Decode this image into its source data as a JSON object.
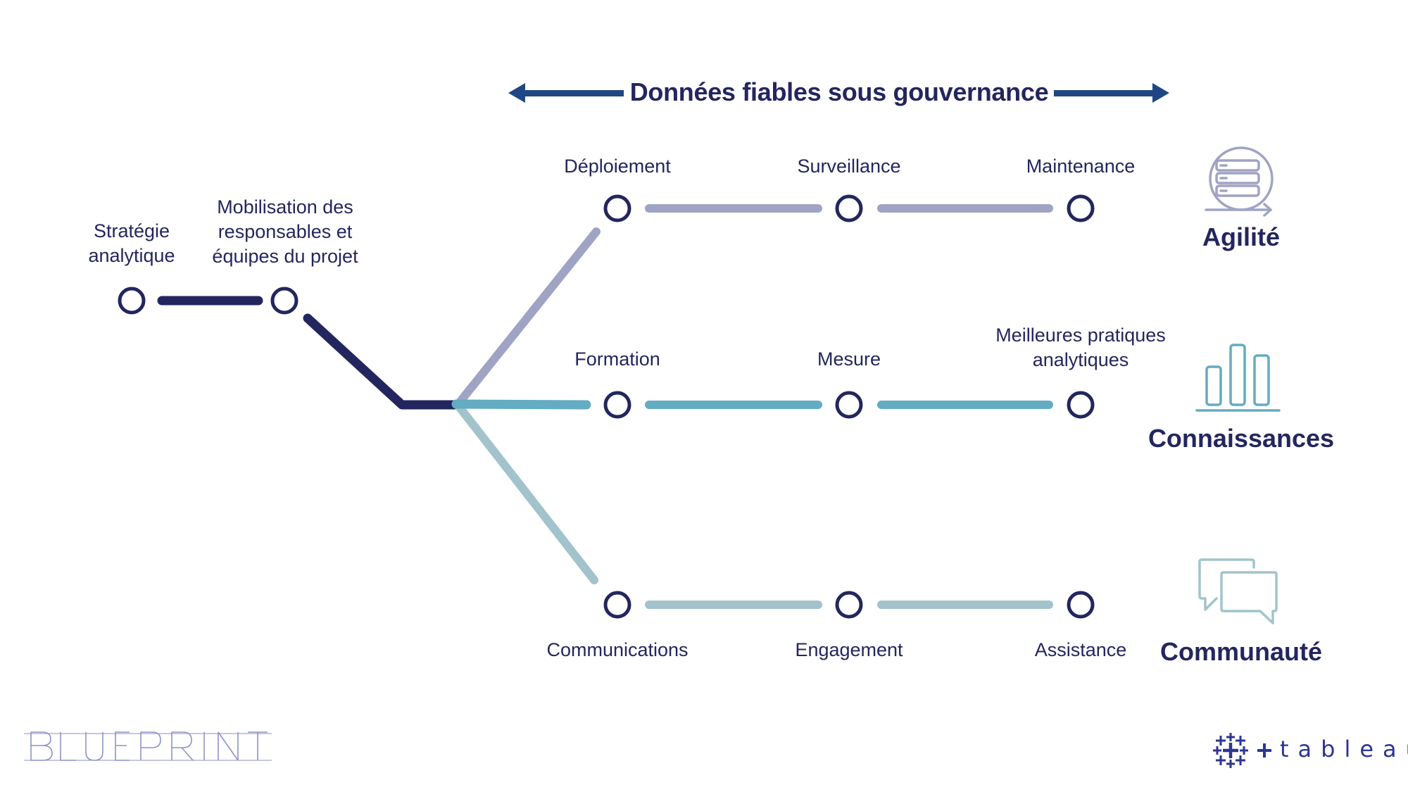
{
  "header": {
    "title": "Données fiables sous gouvernance",
    "arrow_color": "#1f4784"
  },
  "colors": {
    "node_stroke": "#23265e",
    "trunk": "#23265e",
    "agility": "#a0a3c4",
    "knowledge": "#63acc2",
    "community": "#a2c3cc",
    "text": "#23265e"
  },
  "trunk": {
    "nodes": [
      {
        "label_lines": [
          "Stratégie",
          "analytique"
        ]
      },
      {
        "label_lines": [
          "Mobilisation des",
          "responsables et",
          "équipes du projet"
        ]
      }
    ]
  },
  "branches": [
    {
      "id": "agility",
      "nodes": [
        {
          "label_lines": [
            "Déploiement"
          ]
        },
        {
          "label_lines": [
            "Surveillance"
          ]
        },
        {
          "label_lines": [
            "Maintenance"
          ]
        }
      ],
      "outcome": {
        "label": "Agilité",
        "icon": "server-stack-cycle-icon"
      }
    },
    {
      "id": "knowledge",
      "nodes": [
        {
          "label_lines": [
            "Formation"
          ]
        },
        {
          "label_lines": [
            "Mesure"
          ]
        },
        {
          "label_lines": [
            "Meilleures pratiques",
            "analytiques"
          ]
        }
      ],
      "outcome": {
        "label": "Connaissances",
        "icon": "bar-chart-icon"
      }
    },
    {
      "id": "community",
      "nodes": [
        {
          "label_lines": [
            "Communications"
          ]
        },
        {
          "label_lines": [
            "Engagement"
          ]
        },
        {
          "label_lines": [
            "Assistance"
          ]
        }
      ],
      "outcome": {
        "label": "Communauté",
        "icon": "chat-bubbles-icon"
      }
    }
  ],
  "footer": {
    "left_logo": "BLUEPRINT",
    "right_logo": "tableau"
  }
}
